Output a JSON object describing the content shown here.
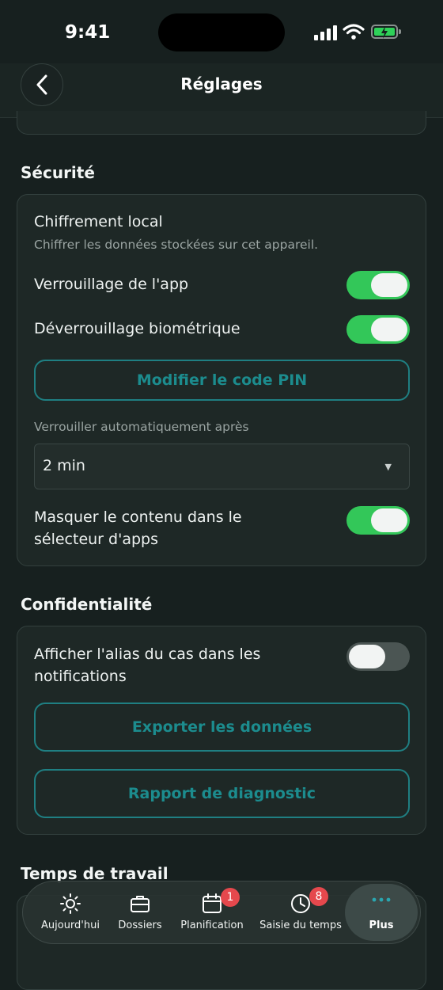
{
  "status_bar": {
    "time": "9:41"
  },
  "header": {
    "title": "Réglages"
  },
  "security": {
    "title": "Sécurité",
    "local_encryption": {
      "label": "Chiffrement local",
      "description": "Chiffrer les données stockées sur cet appareil."
    },
    "app_lock": {
      "label": "Verrouillage de l'app",
      "enabled": true
    },
    "biometric_unlock": {
      "label": "Déverrouillage biométrique",
      "enabled": true
    },
    "change_pin_label": "Modifier le code PIN",
    "auto_lock": {
      "label": "Verrouiller automatiquement après",
      "value": "2 min"
    },
    "hide_content": {
      "label_line1": "Masquer le contenu dans le",
      "label_line2": "sélecteur d'apps",
      "enabled": true
    }
  },
  "privacy": {
    "title": "Confidentialité",
    "show_alias": {
      "label_line1": "Afficher l'alias du cas dans les",
      "label_line2": "notifications",
      "enabled": false
    },
    "export_label": "Exporter les données",
    "diagnostic_label": "Rapport de diagnostic"
  },
  "work_time": {
    "title": "Temps de travail"
  },
  "tabbar": {
    "tabs": [
      {
        "label": "Aujourd'hui",
        "icon": "sun-icon"
      },
      {
        "label": "Dossiers",
        "icon": "briefcase-icon"
      },
      {
        "label": "Planification",
        "icon": "calendar-icon",
        "badge": "1"
      },
      {
        "label": "Saisie du temps",
        "icon": "clock-icon",
        "badge": "8"
      },
      {
        "label": "Plus",
        "icon": "more-icon",
        "active": true
      }
    ]
  },
  "colors": {
    "background": "#17201f",
    "card": "#1e2826",
    "toggle_on": "#33c759",
    "accent": "#1c8c8e",
    "badge": "#e5484d"
  }
}
